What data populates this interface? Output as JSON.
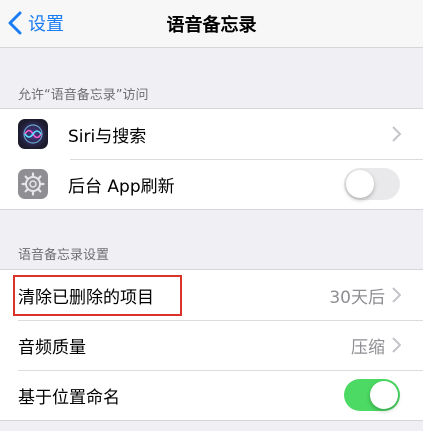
{
  "nav": {
    "back_label": "设置",
    "title": "语音备忘录"
  },
  "section1": {
    "header": "允许“语音备忘录”访问",
    "items": [
      {
        "label": "Siri与搜索",
        "icon": "siri-icon",
        "accessory": "chevron"
      },
      {
        "label": "后台 App刷新",
        "icon": "gear-icon",
        "accessory": "toggle",
        "toggle_on": false
      }
    ]
  },
  "section2": {
    "header": "语音备忘录设置",
    "items": [
      {
        "label": "清除已删除的项目",
        "value": "30天后",
        "accessory": "chevron",
        "highlighted": true
      },
      {
        "label": "音频质量",
        "value": "压缩",
        "accessory": "chevron"
      },
      {
        "label": "基于位置命名",
        "accessory": "toggle",
        "toggle_on": true
      }
    ]
  },
  "colors": {
    "tint": "#1a7cf5",
    "toggle_on": "#4cd964",
    "highlight_border": "#d9332a",
    "background": "#efeff4"
  }
}
